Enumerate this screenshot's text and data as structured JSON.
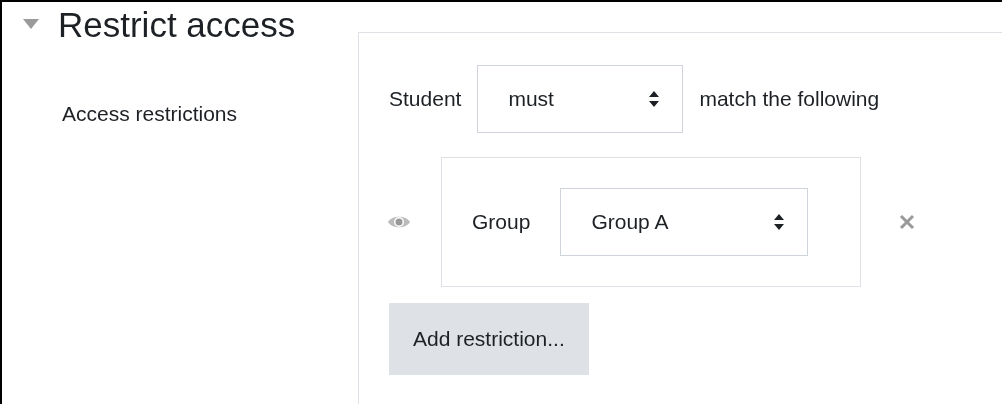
{
  "section": {
    "title": "Restrict access",
    "expanded": true
  },
  "field_label": "Access restrictions",
  "restriction_set": {
    "prefix": "Student",
    "select_value": "must",
    "suffix": "match the following",
    "conditions": [
      {
        "label": "Group",
        "select_value": "Group A"
      }
    ],
    "add_button": "Add restriction..."
  }
}
